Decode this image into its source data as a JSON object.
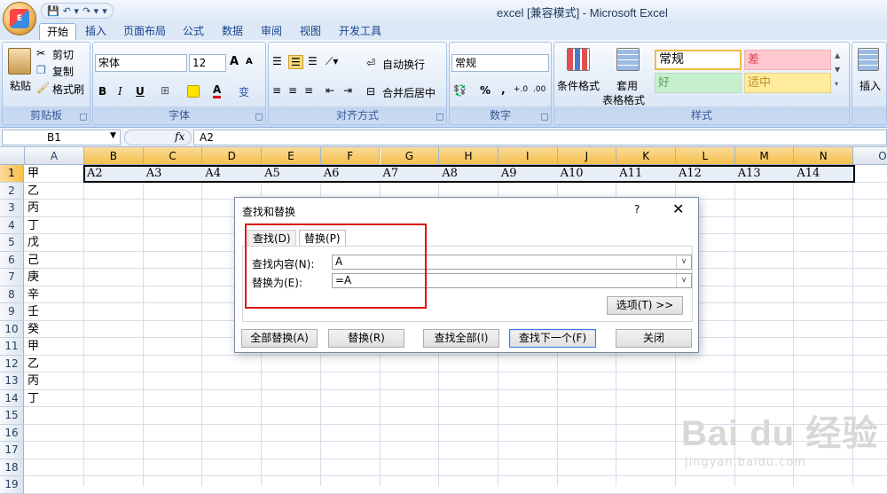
{
  "window": {
    "title": "excel  [兼容模式] - Microsoft Excel"
  },
  "office_button": {
    "logo": "E"
  },
  "quick_access": {
    "save": "💾",
    "undo": "↶ ▾",
    "redo": "↷ ▾",
    "more": "▾"
  },
  "ribbon_tabs": [
    "开始",
    "插入",
    "页面布局",
    "公式",
    "数据",
    "审阅",
    "视图",
    "开发工具"
  ],
  "ribbon": {
    "clipboard": {
      "label": "剪贴板",
      "paste": "粘贴",
      "cut": "剪切",
      "copy": "复制",
      "format_painter": "格式刷"
    },
    "font": {
      "label": "字体",
      "font_name": "宋体",
      "font_size": "12",
      "bold": "B",
      "italic": "I",
      "underline": "U",
      "grow": "A",
      "shrink": "A",
      "font_color": "A",
      "phonetic": "变"
    },
    "alignment": {
      "label": "对齐方式",
      "wrap_text": "自动换行",
      "merge_center": "合并后居中"
    },
    "number": {
      "label": "数字",
      "format": "常规",
      "percent": "%",
      "comma": ",",
      "inc_dec": "+.0",
      "dec_dec": ".00"
    },
    "styles": {
      "label": "样式",
      "conditional": "条件格式",
      "table_format_1": "套用",
      "table_format_2": "表格格式",
      "normal": "常规",
      "bad": "差",
      "good": "好",
      "neutral": "适中"
    },
    "cells": {
      "insert": "插入"
    }
  },
  "formula_bar": {
    "name_box": "B1",
    "fx": "fx",
    "formula": "A2"
  },
  "sheet": {
    "columns": [
      "A",
      "B",
      "C",
      "D",
      "E",
      "F",
      "G",
      "H",
      "I",
      "J",
      "K",
      "L",
      "M",
      "N",
      "O"
    ],
    "rows": [
      "1",
      "2",
      "3",
      "4",
      "5",
      "6",
      "7",
      "8",
      "9",
      "10",
      "11",
      "12",
      "13",
      "14",
      "15",
      "16",
      "17",
      "18",
      "19"
    ],
    "col_a": [
      "甲",
      "乙",
      "丙",
      "丁",
      "戊",
      "己",
      "庚",
      "辛",
      "壬",
      "癸",
      "甲",
      "乙",
      "丙",
      "丁"
    ],
    "row1": [
      "A2",
      "A3",
      "A4",
      "A5",
      "A6",
      "A7",
      "A8",
      "A9",
      "A10",
      "A11",
      "A12",
      "A13",
      "A14"
    ]
  },
  "dialog": {
    "title": "查找和替换",
    "help": "?",
    "close": "✕",
    "tab_find": "查找(D)",
    "tab_replace": "替换(P)",
    "find_label": "查找内容(N):",
    "find_value": "A",
    "replace_label": "替换为(E):",
    "replace_value": "=A",
    "options_button": "选项(T) >>",
    "replace_all": "全部替换(A)",
    "replace": "替换(R)",
    "find_all": "查找全部(I)",
    "find_next": "查找下一个(F)",
    "close_button": "关闭"
  },
  "watermark": {
    "brand": "Bai du 经验",
    "url": "jingyan.baidu.com"
  }
}
